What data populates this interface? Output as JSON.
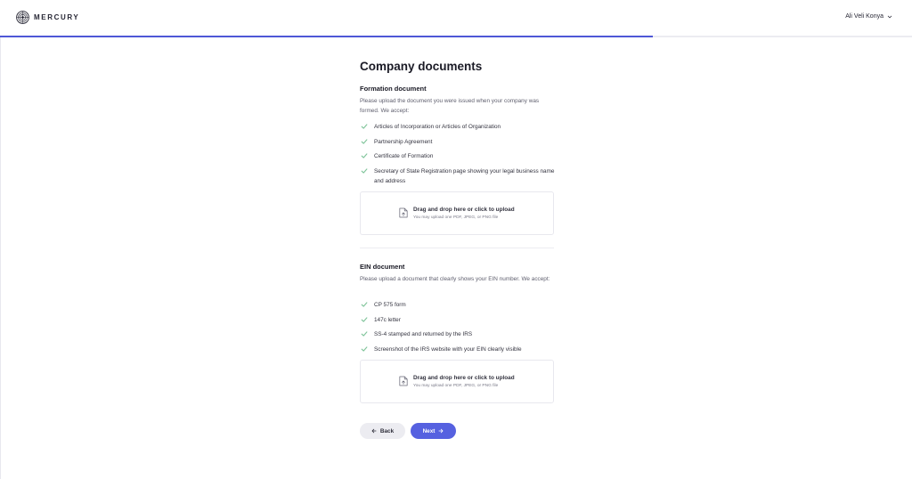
{
  "header": {
    "brand": "MERCURY",
    "user_name": "Ali Veli Konya",
    "progress": 0.716
  },
  "colors": {
    "accent": "#5661e0",
    "progress": "#4e57d6",
    "check": "#7fc49a"
  },
  "page": {
    "title": "Company documents"
  },
  "formation": {
    "title": "Formation document",
    "description": "Please upload the document you were issued when your company was formed. We accept:",
    "items": [
      "Articles of Incorporation or Articles of Organization",
      "Partnership Agreement",
      "Certificate of Formation",
      "Secretary of State Registration page showing your legal business name and address"
    ],
    "upload": {
      "title": "Drag and drop here or click to upload",
      "subtitle": "You may upload one PDF, JPEG, or PNG file"
    }
  },
  "ein": {
    "title": "EIN document",
    "description": "Please upload a document that clearly shows your EIN number. We accept:",
    "items": [
      "CP 575 form",
      "147c letter",
      "SS-4 stamped and returned by the IRS",
      "Screenshot of the IRS website with your EIN clearly visible"
    ],
    "upload": {
      "title": "Drag and drop here or click to upload",
      "subtitle": "You may upload one PDF, JPEG, or PNG file"
    }
  },
  "actions": {
    "back_label": "Back",
    "next_label": "Next"
  },
  "icons": {
    "logo": "mercury-logo-icon",
    "user_menu": "chevron-down-icon",
    "check": "check-icon",
    "upload": "file-upload-icon",
    "back": "arrow-left-icon",
    "next": "arrow-right-icon"
  }
}
